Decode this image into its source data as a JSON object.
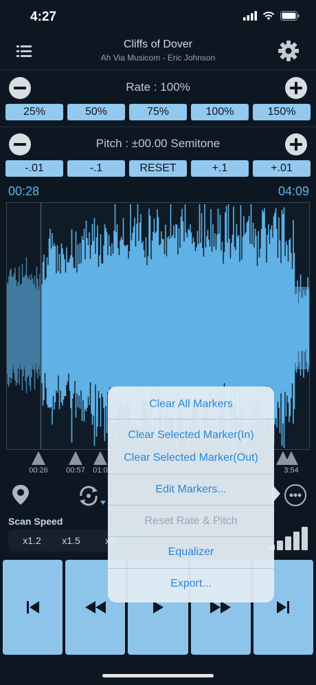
{
  "status": {
    "time": "4:27"
  },
  "header": {
    "title": "Cliffs of Dover",
    "subtitle": "Ah Via Musicom - Eric Johnson"
  },
  "rate": {
    "label": "Rate : 100%",
    "presets": [
      "25%",
      "50%",
      "75%",
      "100%",
      "150%"
    ]
  },
  "pitch": {
    "label": "Pitch : ±00.00  Semitone",
    "presets": [
      "-.01",
      "-.1",
      "RESET",
      "+.1",
      "+.01"
    ]
  },
  "timeline": {
    "current": "00:28",
    "total": "04:09",
    "played_fraction": 0.11
  },
  "markers": [
    "00:26",
    "00:57",
    "01:0",
    "",
    "",
    "",
    "",
    "",
    "3:54"
  ],
  "scan": {
    "label": "Scan Speed",
    "options": [
      "x1.2",
      "x1.5",
      "x2"
    ]
  },
  "menu": {
    "items": [
      {
        "label": "Clear All Markers",
        "enabled": true
      },
      {
        "label": "Clear Selected Marker(In)",
        "enabled": true
      },
      {
        "label": "Clear Selected Marker(Out)",
        "enabled": true
      },
      {
        "label": "Edit Markers...",
        "enabled": true
      },
      {
        "label": "Reset Rate & Pitch",
        "enabled": false
      },
      {
        "label": "Equalizer",
        "enabled": true
      },
      {
        "label": "Export...",
        "enabled": true
      }
    ]
  },
  "colors": {
    "accent": "#5fb4ea",
    "button": "#93c9ee",
    "background": "#0d1722",
    "menu_text": "#2a86d6"
  },
  "icons": [
    "list-icon",
    "gear-icon",
    "minus-icon",
    "plus-icon",
    "location-pin-icon",
    "loop-icon",
    "more-icon",
    "skip-back-icon",
    "rewind-icon",
    "play-icon",
    "fast-forward-icon",
    "skip-forward-icon"
  ]
}
